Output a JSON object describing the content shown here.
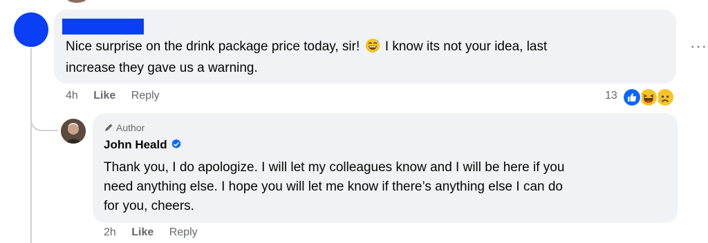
{
  "comment": {
    "author_redacted": true,
    "text_before_emoji": "Nice surprise on the drink package price today, sir!",
    "emoji_name": "grinning-sweat-emoji",
    "text_line1_after": "I know its not your idea, last",
    "text_line2": "increase they gave us a warning.",
    "time": "4h",
    "like_label": "Like",
    "reply_label": "Reply",
    "reaction_count": "13",
    "reactions": [
      "like",
      "haha",
      "sad"
    ]
  },
  "reply": {
    "badge_label": "Author",
    "name": "John Heald",
    "verified": true,
    "lines": [
      "Thank you, I do apologize. I will let my colleagues know and I will be here if you",
      "need anything else. I hope you will let me know if there’s anything else I can do",
      "for you, cheers."
    ],
    "time": "2h",
    "like_label": "Like",
    "reply_label": "Reply"
  },
  "colors": {
    "bubble": "#f0f2f5",
    "meta_text": "#65676b",
    "facebook_blue": "#0866ff",
    "redaction": "#0a3ff5"
  }
}
